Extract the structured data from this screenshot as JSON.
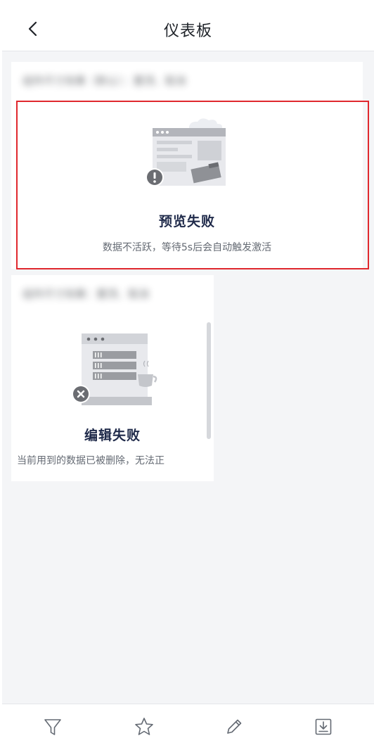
{
  "header": {
    "title": "仪表板",
    "back_icon": "chevron-left-icon"
  },
  "cards": [
    {
      "blurred_title": "组件尺寸效果（默认）：置顶、取消",
      "error_title": "预览失败",
      "error_desc": "数据不活跃，等待5s后会自动触发激活",
      "illustration": "preview-failed-illustration"
    },
    {
      "blurred_title": "组件尺寸效果：置顶、取消",
      "error_title": "编辑失败",
      "error_desc": "当前用到的数据已被删除，无法正",
      "illustration": "edit-failed-illustration"
    }
  ],
  "footer": {
    "tools": [
      "filter-icon",
      "star-icon",
      "pencil-icon",
      "download-icon"
    ]
  },
  "colors": {
    "highlight": "#e0282e",
    "title_text": "#1f2a4a",
    "desc_text": "#646a73",
    "background": "#f4f5f7"
  }
}
